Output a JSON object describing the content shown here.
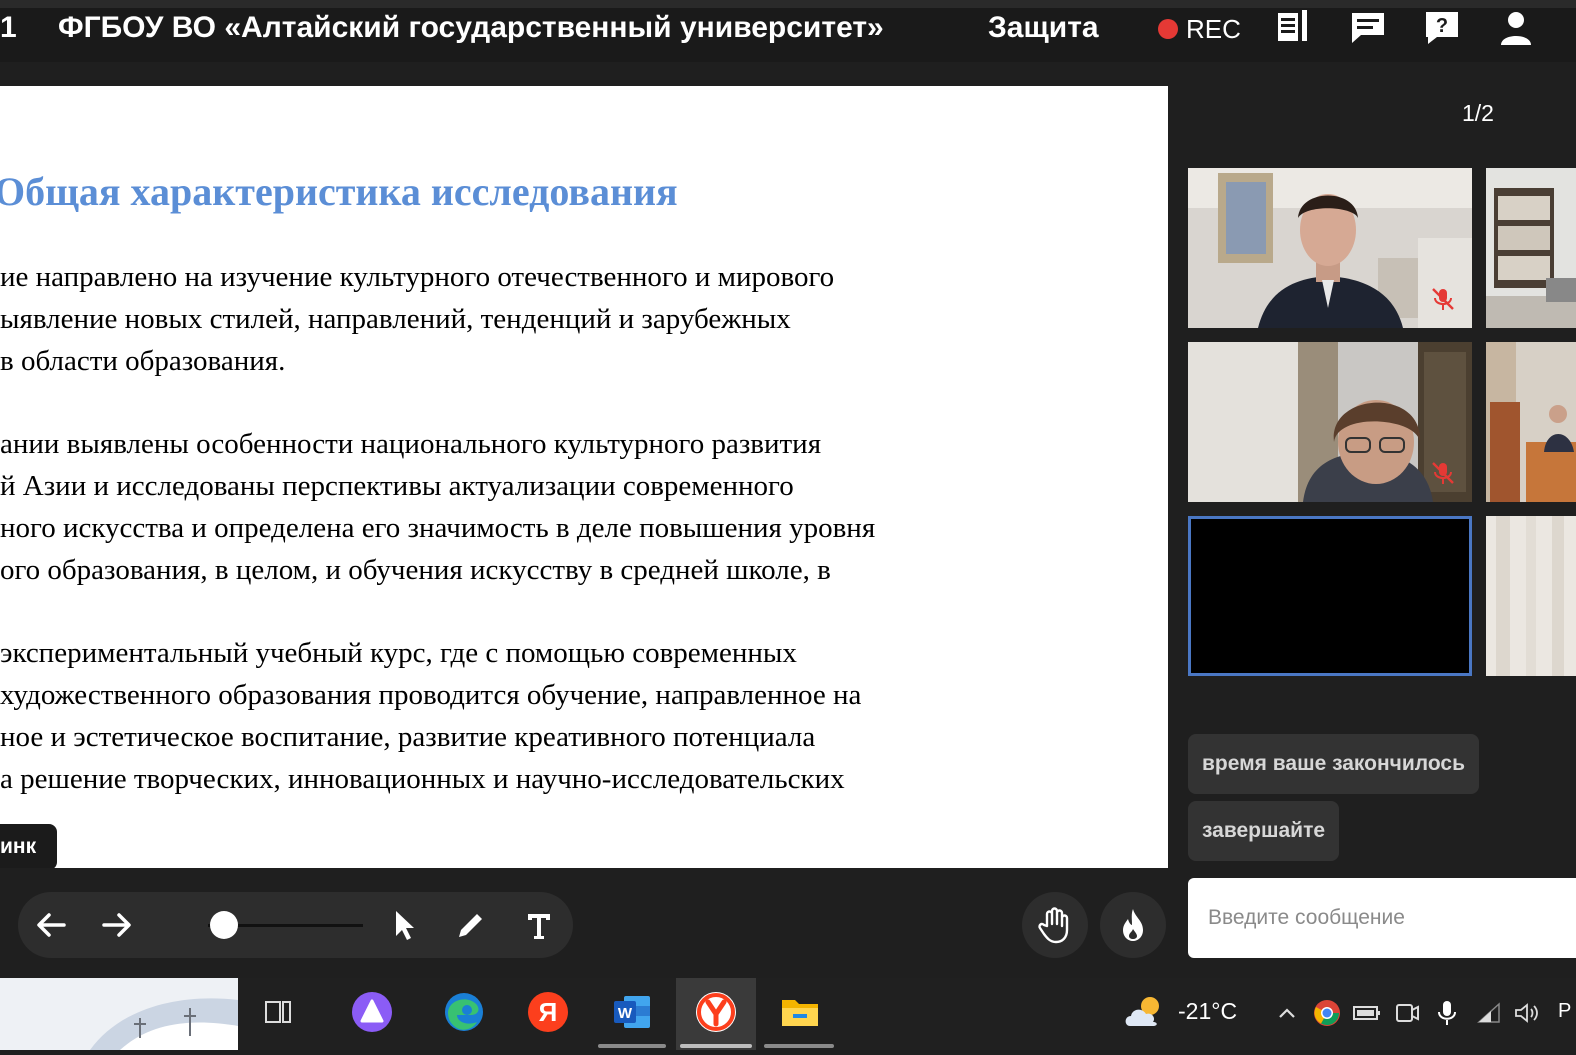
{
  "topbar": {
    "counter": "1",
    "title": "ФГБОУ ВО «Алтайский государственный университет»",
    "mode": "Защита",
    "rec_label": "REC"
  },
  "slide": {
    "title": "Общая характеристика исследования",
    "paragraphs": [
      {
        "lines": [
          "ие направлено на изучение культурного отечественного и мирового",
          "ыявление новых стилей, направлений, тенденций и зарубежных",
          "в области образования."
        ]
      },
      {
        "lines": [
          "ании выявлены особенности национального культурного развития",
          "й Азии и исследованы перспективы актуализации современного",
          "ного искусства и  определена его значимость в деле  повышения уровня",
          "ого образования, в целом, и обучения искусству в средней школе, в"
        ]
      },
      {
        "lines": [
          " экспериментальный учебный курс, где с помощью современных",
          "художественного образования проводится обучение, направленное на",
          "ное и эстетическое воспитание, развитие креативного потенциала",
          "а решение творческих, инновационных и научно-исследовательских"
        ]
      }
    ],
    "ink_label": "инк"
  },
  "toolbar": {
    "slider_value": 0.1
  },
  "video": {
    "page_indicator": "1/2"
  },
  "chat": {
    "messages": [
      "время ваше закончилось",
      "завершайте"
    ],
    "input_placeholder": "Введите сообщение"
  },
  "taskbar": {
    "temperature": "-21°C",
    "tray_letter": "Р"
  },
  "colors": {
    "slide_title": "#5b8ed6",
    "rec_dot": "#e53935",
    "selected_tile_border": "#4a77c4",
    "muted_mic": "#e53935"
  }
}
